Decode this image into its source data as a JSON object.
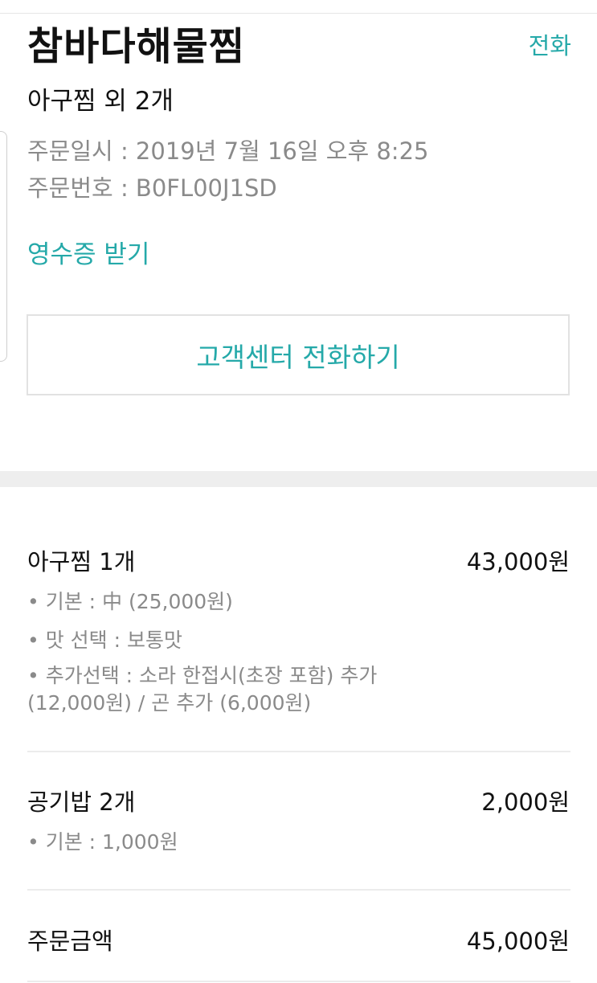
{
  "store": {
    "name": "참바다해물찜",
    "call_label": "전화"
  },
  "order": {
    "summary": "아구찜 외 2개",
    "date_line": "주문일시 : 2019년 7월 16일 오후 8:25",
    "number_line": "주문번호 : B0FL00J1SD",
    "receipt_label": "영수증 받기"
  },
  "customer_center_button": "고객센터 전화하기",
  "items": [
    {
      "name": "아구찜 1개",
      "price": "43,000원",
      "options": [
        "• 기본 : 中 (25,000원)",
        "• 맛 선택 : 보통맛",
        "• 추가선택 : 소라 한접시(초장 포함) 추가",
        "(12,000원) / 곤 추가 (6,000원)"
      ]
    },
    {
      "name": "공기밥 2개",
      "price": "2,000원",
      "options": [
        "• 기본 : 1,000원"
      ]
    }
  ],
  "total": {
    "label": "주문금액",
    "amount": "45,000원"
  },
  "colors": {
    "accent": "#25a9a9",
    "muted_text": "#8a8a8a",
    "divider": "#ececec",
    "section_band": "#eeeeee"
  }
}
